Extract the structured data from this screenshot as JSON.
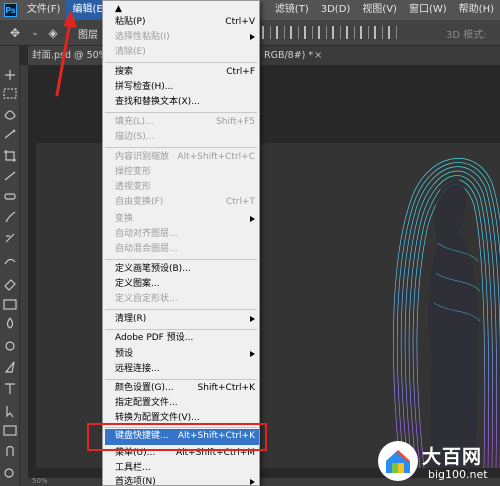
{
  "menubar": {
    "logo": "Ps",
    "items": [
      "文件(F)",
      "编辑(E)",
      "滤镜(T)",
      "3D(D)",
      "视图(V)",
      "窗口(W)",
      "帮助(H)"
    ]
  },
  "optionsbar": {
    "layer_label": "图层",
    "mode_3d_label": "3D 模式:"
  },
  "tabs": {
    "doc1": "封面.psd @ 50%",
    "doc2": "RGB/8#) *",
    "close": "×"
  },
  "statusbar": {
    "zoom": "50%"
  },
  "edit_menu": {
    "top_item": "▲",
    "items": [
      {
        "label": "粘贴(P)",
        "shortcut": "Ctrl+V",
        "enabled": true
      },
      {
        "label": "选择性粘贴(I)",
        "shortcut": "",
        "enabled": false,
        "submenu": true
      },
      {
        "label": "清除(E)",
        "shortcut": "",
        "enabled": false
      },
      {
        "label": "搜索",
        "shortcut": "Ctrl+F",
        "enabled": true
      },
      {
        "label": "拼写检查(H)...",
        "shortcut": "",
        "enabled": true
      },
      {
        "label": "查找和替换文本(X)...",
        "shortcut": "",
        "enabled": true
      },
      {
        "label": "填充(L)...",
        "shortcut": "Shift+F5",
        "enabled": false
      },
      {
        "label": "描边(S)...",
        "shortcut": "",
        "enabled": false
      },
      {
        "label": "内容识别缩放",
        "shortcut": "Alt+Shift+Ctrl+C",
        "enabled": false
      },
      {
        "label": "操控变形",
        "shortcut": "",
        "enabled": false
      },
      {
        "label": "透视变形",
        "shortcut": "",
        "enabled": false
      },
      {
        "label": "自由变换(F)",
        "shortcut": "Ctrl+T",
        "enabled": false
      },
      {
        "label": "变换",
        "shortcut": "",
        "enabled": false,
        "submenu": true
      },
      {
        "label": "自动对齐图层...",
        "shortcut": "",
        "enabled": false
      },
      {
        "label": "自动混合图层...",
        "shortcut": "",
        "enabled": false
      },
      {
        "label": "定义画笔预设(B)...",
        "shortcut": "",
        "enabled": true
      },
      {
        "label": "定义图案...",
        "shortcut": "",
        "enabled": true
      },
      {
        "label": "定义自定形状...",
        "shortcut": "",
        "enabled": false
      },
      {
        "label": "清理(R)",
        "shortcut": "",
        "enabled": true,
        "submenu": true
      },
      {
        "label": "Adobe PDF 预设...",
        "shortcut": "",
        "enabled": true
      },
      {
        "label": "预设",
        "shortcut": "",
        "enabled": true,
        "submenu": true
      },
      {
        "label": "远程连接...",
        "shortcut": "",
        "enabled": true
      },
      {
        "label": "颜色设置(G)...",
        "shortcut": "Shift+Ctrl+K",
        "enabled": true
      },
      {
        "label": "指定配置文件...",
        "shortcut": "",
        "enabled": true
      },
      {
        "label": "转换为配置文件(V)...",
        "shortcut": "",
        "enabled": true
      },
      {
        "label": "键盘快捷键...",
        "shortcut": "Alt+Shift+Ctrl+K",
        "enabled": true,
        "highlighted": true
      },
      {
        "label": "菜单(U)...",
        "shortcut": "Alt+Shift+Ctrl+M",
        "enabled": true
      },
      {
        "label": "工具栏...",
        "shortcut": "",
        "enabled": true
      },
      {
        "label": "首选项(N)",
        "shortcut": "",
        "enabled": true,
        "submenu": true
      }
    ]
  },
  "watermark": {
    "title": "大百网",
    "url": "big100.net"
  },
  "colors": {
    "menubar": "#535353",
    "highlight": "#3574c7",
    "annotation_red": "#e0261e",
    "figure_cyan": "#37e0e6",
    "figure_purple": "#b35cf5"
  }
}
